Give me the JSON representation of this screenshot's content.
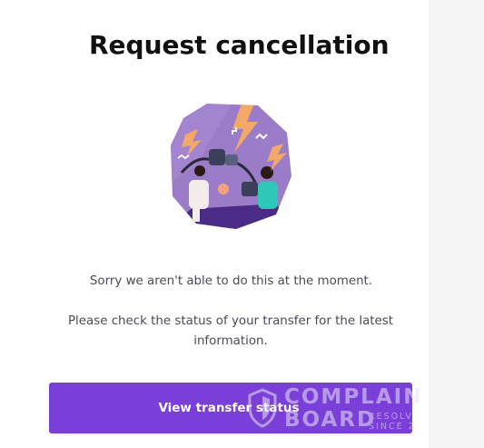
{
  "dialog": {
    "title": "Request cancellation",
    "message": "Sorry we aren't able to do this at the moment.",
    "detail": "Please check the status of your transfer for the latest information.",
    "illustration_icon": "unplugged-cable-illustration"
  },
  "actions": {
    "view_status_label": "View transfer status"
  },
  "watermark": {
    "line1": "COMPLAIN",
    "line2": "BOARD",
    "line3": "RESOLV",
    "line4": "SINCE 2",
    "icon": "shield-icon"
  },
  "colors": {
    "accent": "#7a3ed9",
    "illustration_bg": "#9a7cc8",
    "title_text": "#111111",
    "body_text": "#4a4a58"
  }
}
